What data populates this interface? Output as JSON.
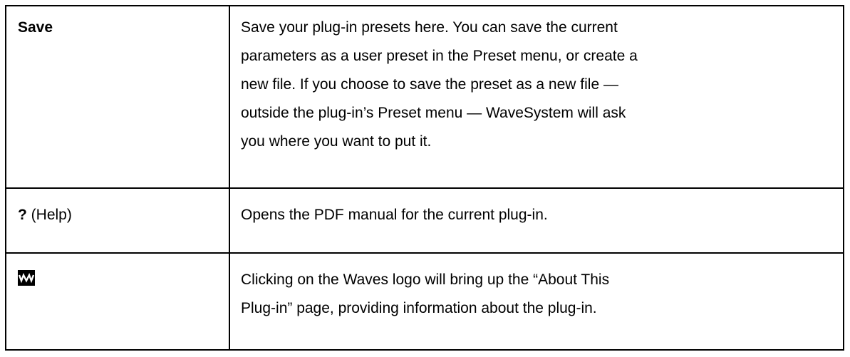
{
  "rows": [
    {
      "term": "Save",
      "description": [
        "Save your plug-in presets here. You can save the current",
        "parameters as a user preset in the Preset menu, or create a",
        "new file. If you choose to save the preset as a new file —",
        "outside the plug-in’s Preset menu — WaveSystem will ask",
        "you where you want to put it."
      ]
    },
    {
      "term_bold": "?",
      "term_rest": " (Help)",
      "description": [
        "Opens the PDF manual for the current plug-in."
      ]
    },
    {
      "term_icon": "waves-logo-icon",
      "description": [
        "Clicking on the Waves logo will bring up the “About This",
        "Plug-in” page, providing information about the plug-in."
      ]
    }
  ]
}
